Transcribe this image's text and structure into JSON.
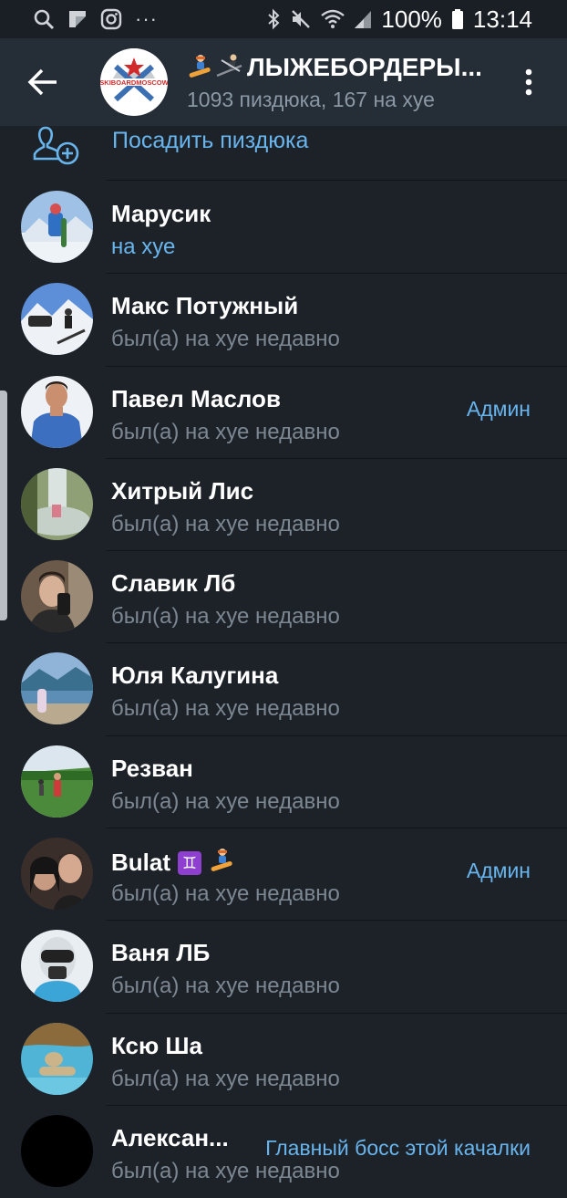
{
  "status_bar": {
    "battery": "100%",
    "time": "13:14",
    "icons": [
      "search-icon",
      "flipboard-icon",
      "instagram-icon",
      "more-notifications-icon",
      "bluetooth-icon",
      "mute-icon",
      "wifi-icon",
      "signal-icon",
      "battery-icon"
    ],
    "more": "···"
  },
  "header": {
    "title": "ЛЫЖЕБОРДЕРЫ...",
    "title_emoji": [
      "snowboarder-emoji",
      "skier-emoji"
    ],
    "subtitle": "1093 пиздюка, 167 на хуе",
    "avatar_logo": "SKIBOARDMOSCOW"
  },
  "add_member": {
    "label": "Посадить пиздюка"
  },
  "members": [
    {
      "name": "Марусик",
      "status": "на хуе",
      "online": true,
      "role": "",
      "avatar_colors": [
        "#2f6fc4",
        "#d7e3ef",
        "#ffffff"
      ]
    },
    {
      "name": "Макс Потужный",
      "status": "был(а) на хуе недавно",
      "online": false,
      "role": "",
      "avatar_colors": [
        "#4a7bd0",
        "#e8eef5",
        "#2b2b2b"
      ]
    },
    {
      "name": "Павел Маслов",
      "status": "был(а) на хуе недавно",
      "online": false,
      "role": "Админ",
      "avatar_colors": [
        "#3d6fc1",
        "#c98f6f",
        "#eef2f6"
      ]
    },
    {
      "name": "Хитрый Лис",
      "status": "был(а) на хуе недавно",
      "online": false,
      "role": "",
      "avatar_colors": [
        "#b9c4a8",
        "#6a7b54",
        "#e8e2de"
      ]
    },
    {
      "name": "Славик Лб",
      "status": "был(а) на хуе недавно",
      "online": false,
      "role": "",
      "avatar_colors": [
        "#6b5a4a",
        "#d6b197",
        "#2a2a2a"
      ]
    },
    {
      "name": "Юля Калугина",
      "status": "был(а) на хуе недавно",
      "online": false,
      "role": "",
      "avatar_colors": [
        "#7fa3c6",
        "#3b6f8e",
        "#b9a98f"
      ]
    },
    {
      "name": "Резван",
      "status": "был(а) на хуе недавно",
      "online": false,
      "role": "",
      "avatar_colors": [
        "#dbe6ee",
        "#4a8a3a",
        "#2e6b25"
      ]
    },
    {
      "name": "Bulat",
      "name_badges": [
        "♊",
        "snowboarder-emoji"
      ],
      "status": "был(а) на хуе недавно",
      "online": false,
      "role": "Админ",
      "avatar_colors": [
        "#3a2e2a",
        "#c79b82",
        "#151515"
      ]
    },
    {
      "name": "Ваня ЛБ",
      "status": "был(а) на хуе недавно",
      "online": false,
      "role": "",
      "avatar_colors": [
        "#e9eef3",
        "#2f2f2f",
        "#3ba5d8"
      ]
    },
    {
      "name": "Ксю Ша",
      "status": "был(а) на хуе недавно",
      "online": false,
      "role": "",
      "avatar_colors": [
        "#4fb4d6",
        "#8b6a3c",
        "#cbb38a"
      ]
    },
    {
      "name": "Алексан...",
      "status": "был(а) на хуе недавно",
      "online": false,
      "role": "Главный босс этой качалки",
      "avatar_colors": [
        "#000000",
        "#000000",
        "#000000"
      ]
    }
  ]
}
